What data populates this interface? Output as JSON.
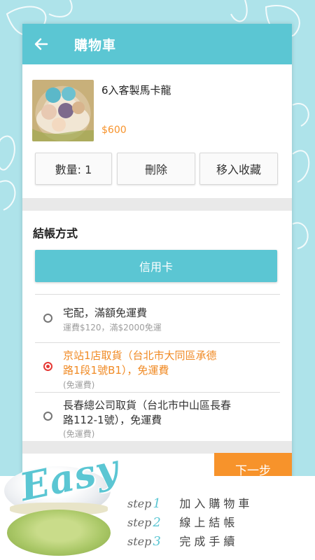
{
  "appbar": {
    "title": "購物車",
    "back_icon": "arrow-left-icon"
  },
  "product": {
    "name": "6入客製馬卡龍",
    "price": "$600"
  },
  "actions": {
    "quantity": "數量: 1",
    "delete": "刪除",
    "favorite": "移入收藏"
  },
  "checkout": {
    "title": "結帳方式",
    "payment": "信用卡",
    "options": [
      {
        "title": "宅配，滿額免運費",
        "sub": "運費$120，滿$2000免運",
        "selected": false
      },
      {
        "title_line1": "京站1店取貨（台北市大同區承德",
        "title_line2": "路1段1號B1），免運費",
        "sub": "(免運費)",
        "selected": true
      },
      {
        "title_line1": "長春總公司取貨（台北市中山區長春",
        "title_line2": "路112-1號），免運費",
        "sub": "(免運費)",
        "selected": false
      }
    ]
  },
  "next": "下一步",
  "promo": {
    "brand": "Easy",
    "steps": [
      {
        "word": "step",
        "num": "1",
        "text": "加入購物車"
      },
      {
        "word": "step",
        "num": "2",
        "text": "線上結帳"
      },
      {
        "word": "step",
        "num": "3",
        "text": "完成手續"
      }
    ]
  },
  "colors": {
    "primary": "#5bc6d3",
    "accent": "#f7932b",
    "selected": "#f08a24",
    "radio_checked": "#e53935"
  }
}
